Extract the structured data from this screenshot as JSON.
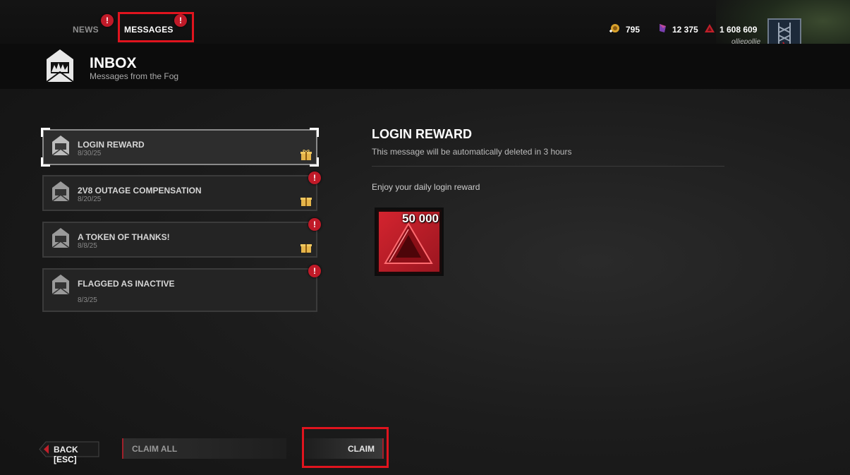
{
  "nav": {
    "tabs": [
      {
        "label": "NEWS",
        "has_alert": true
      },
      {
        "label": "MESSAGES",
        "has_alert": true,
        "active": true
      }
    ],
    "alert_glyph": "!"
  },
  "currencies": [
    {
      "icon": "bloodpoints-icon",
      "value": "795"
    },
    {
      "icon": "iridescent-shards-icon",
      "value": "12 375"
    },
    {
      "icon": "auric-cells-icon",
      "value": "1 608 609"
    }
  ],
  "user": {
    "name": "olliepollie"
  },
  "header": {
    "title": "INBOX",
    "subtitle": "Messages from the Fog"
  },
  "messages": [
    {
      "title": "LOGIN REWARD",
      "date": "8/30/25",
      "has_gift": true,
      "has_alert": false,
      "selected": true
    },
    {
      "title": "2V8 OUTAGE COMPENSATION",
      "date": "8/20/25",
      "has_gift": true,
      "has_alert": true
    },
    {
      "title": "A TOKEN OF THANKS!",
      "date": "8/8/25",
      "has_gift": true,
      "has_alert": true
    },
    {
      "title": "FLAGGED AS INACTIVE",
      "date": "8/3/25",
      "has_gift": false,
      "has_alert": true
    }
  ],
  "detail": {
    "title": "LOGIN REWARD",
    "subtitle": "This message will be automatically deleted in 3 hours",
    "body": "Enjoy your daily login reward",
    "reward": {
      "icon": "auric-cells-icon",
      "amount": "50 000"
    }
  },
  "footer": {
    "back_label": "BACK",
    "back_key": "[ESC]",
    "claim_all_label": "CLAIM ALL",
    "claim_label": "CLAIM"
  },
  "colors": {
    "accent_red": "#e0141e",
    "alert_red": "#c01a28",
    "reward_red": "#d4242f"
  }
}
